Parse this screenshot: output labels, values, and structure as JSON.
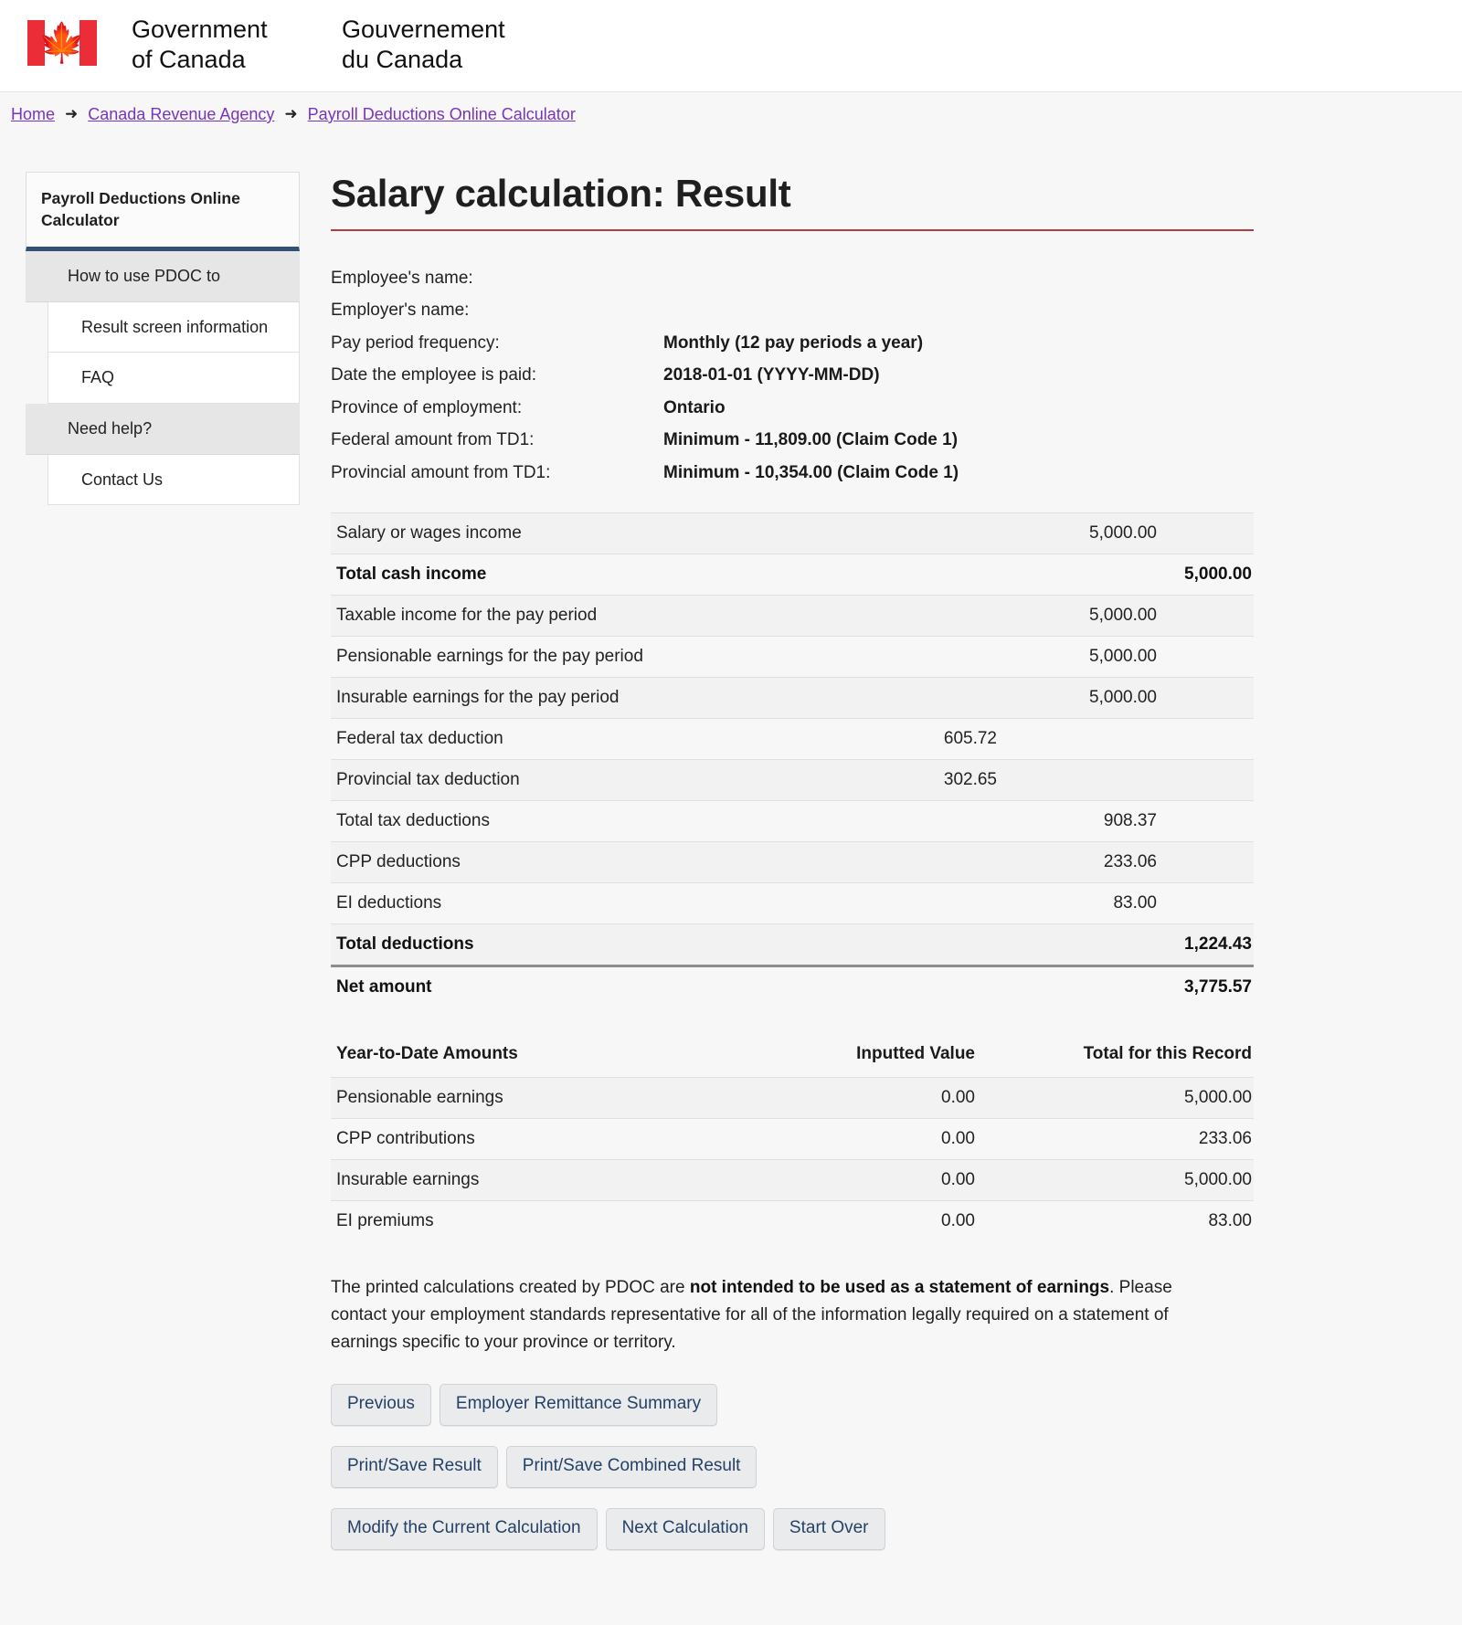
{
  "header": {
    "flag_icon": "canada-flag-icon",
    "wordmark_en_line1": "Government",
    "wordmark_en_line2": "of Canada",
    "wordmark_fr_line1": "Gouvernement",
    "wordmark_fr_line2": "du Canada"
  },
  "breadcrumb": {
    "items": [
      {
        "label": "Home"
      },
      {
        "label": "Canada Revenue Agency"
      },
      {
        "label": "Payroll Deductions Online Calculator"
      }
    ],
    "separator": "➜"
  },
  "sidebar": {
    "title": "Payroll Deductions Online Calculator",
    "section_how": "How to use PDOC to",
    "how_items": [
      {
        "label": "Result screen information"
      },
      {
        "label": "FAQ"
      }
    ],
    "section_help": "Need help?",
    "help_items": [
      {
        "label": "Contact Us"
      }
    ]
  },
  "main": {
    "page_title": "Salary calculation: Result",
    "info": [
      {
        "label": "Employee's name:",
        "value": ""
      },
      {
        "label": "Employer's name:",
        "value": ""
      },
      {
        "label": "Pay period frequency:",
        "value": "Monthly (12 pay periods a year)"
      },
      {
        "label": "Date the employee is paid:",
        "value": "2018-01-01 (YYYY-MM-DD)"
      },
      {
        "label": "Province of employment:",
        "value": "Ontario"
      },
      {
        "label": "Federal amount from TD1:",
        "value": "Minimum - 11,809.00 (Claim Code 1)"
      },
      {
        "label": "Provincial amount from TD1:",
        "value": "Minimum - 10,354.00 (Claim Code 1)"
      }
    ],
    "result_rows": [
      {
        "label": "Salary or wages income",
        "mid": "",
        "amt": "5,000.00",
        "tot": "",
        "bold": false,
        "shaded": true,
        "heavy": false
      },
      {
        "label": "Total cash income",
        "mid": "",
        "amt": "",
        "tot": "5,000.00",
        "bold": true,
        "shaded": false,
        "heavy": false
      },
      {
        "label": "Taxable income for the pay period",
        "mid": "",
        "amt": "5,000.00",
        "tot": "",
        "bold": false,
        "shaded": true,
        "heavy": false
      },
      {
        "label": "Pensionable earnings for the pay period",
        "mid": "",
        "amt": "5,000.00",
        "tot": "",
        "bold": false,
        "shaded": false,
        "heavy": false
      },
      {
        "label": "Insurable earnings for the pay period",
        "mid": "",
        "amt": "5,000.00",
        "tot": "",
        "bold": false,
        "shaded": true,
        "heavy": false
      },
      {
        "label": "Federal tax deduction",
        "mid": "605.72",
        "amt": "",
        "tot": "",
        "bold": false,
        "shaded": false,
        "heavy": false
      },
      {
        "label": "Provincial tax deduction",
        "mid": "302.65",
        "amt": "",
        "tot": "",
        "bold": false,
        "shaded": true,
        "heavy": false
      },
      {
        "label": "Total tax deductions",
        "mid": "",
        "amt": "908.37",
        "tot": "",
        "bold": false,
        "shaded": false,
        "heavy": false
      },
      {
        "label": "CPP deductions",
        "mid": "",
        "amt": "233.06",
        "tot": "",
        "bold": false,
        "shaded": true,
        "heavy": false
      },
      {
        "label": "EI deductions",
        "mid": "",
        "amt": "83.00",
        "tot": "",
        "bold": false,
        "shaded": false,
        "heavy": false
      },
      {
        "label": "Total deductions",
        "mid": "",
        "amt": "",
        "tot": "1,224.43",
        "bold": true,
        "shaded": true,
        "heavy": false
      },
      {
        "label": "Net amount",
        "mid": "",
        "amt": "",
        "tot": "3,775.57",
        "bold": true,
        "shaded": false,
        "heavy": true
      }
    ],
    "ytd": {
      "headers": [
        "Year-to-Date Amounts",
        "Inputted Value",
        "Total for this Record"
      ],
      "rows": [
        {
          "label": "Pensionable earnings",
          "inputted": "0.00",
          "total": "5,000.00",
          "shaded": true
        },
        {
          "label": "CPP contributions",
          "inputted": "0.00",
          "total": "233.06",
          "shaded": false
        },
        {
          "label": "Insurable earnings",
          "inputted": "0.00",
          "total": "5,000.00",
          "shaded": true
        },
        {
          "label": "EI premiums",
          "inputted": "0.00",
          "total": "83.00",
          "shaded": false
        }
      ]
    },
    "disclaimer": {
      "part1": "The printed calculations created by PDOC are ",
      "bold": "not intended to be used as a statement of earnings",
      "part2": ". Please contact your employment standards representative for all of the information legally required on a statement of earnings specific to your province or territory."
    },
    "buttons": {
      "row1": [
        {
          "label": "Previous"
        },
        {
          "label": "Employer Remittance Summary"
        }
      ],
      "row2": [
        {
          "label": "Print/Save Result"
        },
        {
          "label": "Print/Save Combined Result"
        }
      ],
      "row3": [
        {
          "label": "Modify the Current Calculation"
        },
        {
          "label": "Next Calculation"
        },
        {
          "label": "Start Over"
        }
      ]
    }
  },
  "colors": {
    "flag_red": "#ea2d37",
    "title_rule": "#af3c43",
    "sidebar_accent": "#335075",
    "link": "#7834bc",
    "button_text": "#264166"
  }
}
